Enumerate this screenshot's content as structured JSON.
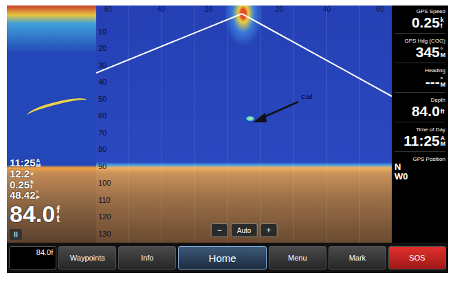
{
  "left_panel": {
    "readings": [
      {
        "value": "11:25",
        "unit": "AM"
      },
      {
        "value": "12.2",
        "unit": "v"
      },
      {
        "value": "0.25",
        "unit": "kt"
      },
      {
        "value": "48.42",
        "unit": "°F"
      }
    ],
    "depth": {
      "value": "84.0",
      "unit": "ft"
    },
    "pause": "II"
  },
  "sonar": {
    "range_ticks": [
      "60",
      "40",
      "20",
      "20",
      "40",
      "60"
    ],
    "depth_ticks": [
      "10",
      "20",
      "30",
      "40",
      "50",
      "60",
      "70",
      "80",
      "90",
      "100",
      "110",
      "120",
      "130"
    ],
    "annotation": "Cod"
  },
  "zoom": {
    "minus": "−",
    "mode": "Auto",
    "plus": "+"
  },
  "data_fields": [
    {
      "label": "GPS Speed",
      "value": "0.25",
      "unit": "kt"
    },
    {
      "label": "GPS Hdg (COG)",
      "value": "345",
      "unit": "°M"
    },
    {
      "label": "Heading",
      "value": "---",
      "unit": "°M"
    },
    {
      "label": "Depth",
      "value": "84.0",
      "unit": "ft"
    },
    {
      "label": "Time of Day",
      "value": "11:25",
      "unit": "AM"
    }
  ],
  "gps_position": {
    "label": "GPS Position",
    "lines": [
      "N",
      "W0"
    ]
  },
  "buttons": [
    {
      "label": "84.0f",
      "kind": "field",
      "selected": false
    },
    {
      "label": "Waypoints",
      "kind": "button",
      "selected": false
    },
    {
      "label": "Info",
      "kind": "button",
      "selected": false
    },
    {
      "label": "Home",
      "kind": "home",
      "selected": true
    },
    {
      "label": "Menu",
      "kind": "button",
      "selected": false
    },
    {
      "label": "Mark",
      "kind": "button",
      "selected": false
    },
    {
      "label": "SOS",
      "kind": "alert",
      "selected": false
    }
  ]
}
